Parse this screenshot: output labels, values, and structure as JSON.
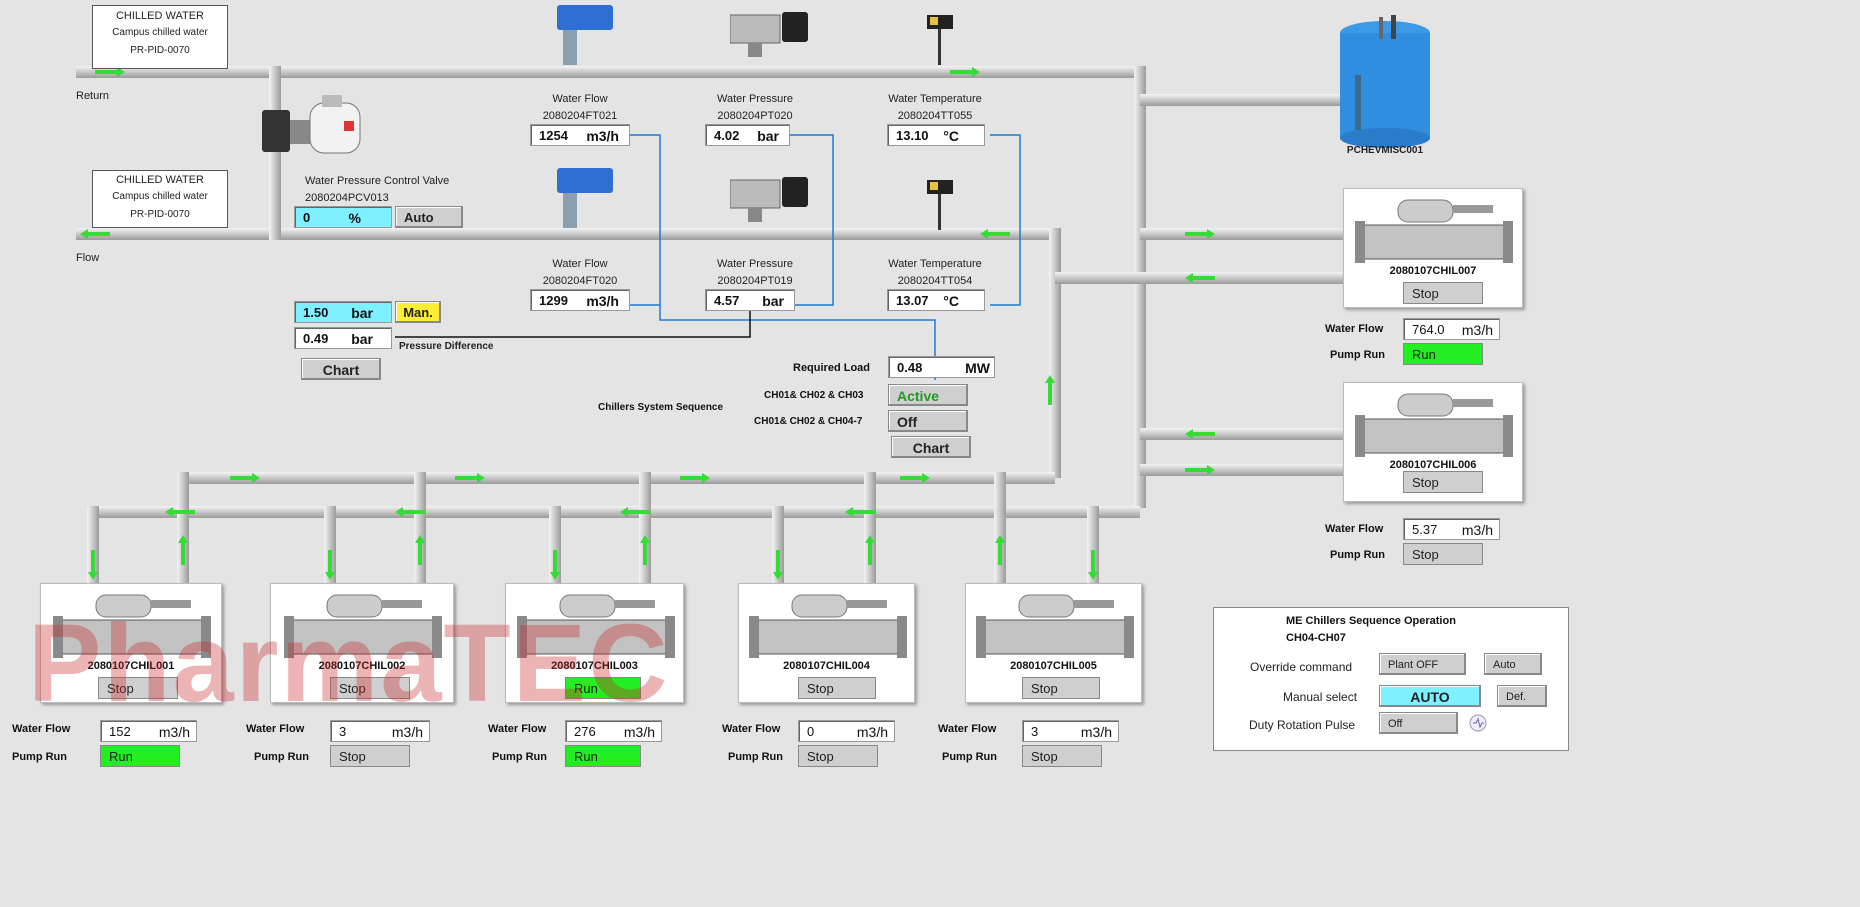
{
  "colors": {
    "pipe": "#c9c9c9",
    "flow_arrow": "#33dd33",
    "run": "#22ee22",
    "signal_line": "#1e7bd0",
    "setpoint_bg": "#7ef0ff",
    "manual_bg": "#ffee33",
    "active_text": "#229922"
  },
  "tag_return": {
    "line1": "CHILLED WATER",
    "line2": "Campus chilled water",
    "line3": "PR-PID-0070"
  },
  "tag_flow": {
    "line1": "CHILLED WATER",
    "line2": "Campus chilled water",
    "line3": "PR-PID-0070"
  },
  "return_label": "Return",
  "flow_label": "Flow",
  "pcv": {
    "title": "Water Pressure Control Valve",
    "tag": "2080204PCV013",
    "value": "0",
    "unit": "%",
    "mode": "Auto"
  },
  "return_sensors": {
    "flow": {
      "title": "Water  Flow",
      "tag": "2080204FT021",
      "value": "1254",
      "unit": "m3/h"
    },
    "pressure": {
      "title": "Water Pressure",
      "tag": "2080204PT020",
      "value": "4.02",
      "unit": "bar"
    },
    "temperature": {
      "title": "Water Temperature",
      "tag": "2080204TT055",
      "value": "13.10",
      "unit": "°C"
    }
  },
  "flow_sensors": {
    "flow": {
      "title": "Water Flow",
      "tag": "2080204FT020",
      "value": "1299",
      "unit": "m3/h"
    },
    "pressure": {
      "title": "Water Pressure",
      "tag": "2080204PT019",
      "value": "4.57",
      "unit": "bar"
    },
    "temperature": {
      "title": "Water Temperature",
      "tag": "2080204TT054",
      "value": "13.07",
      "unit": "°C"
    }
  },
  "dp": {
    "setpoint": "1.50",
    "setpoint_unit": "bar",
    "mode": "Man.",
    "actual": "0.49",
    "actual_unit": "bar",
    "label": "Pressure Difference",
    "chart_button": "Chart"
  },
  "load": {
    "label": "Required Load",
    "value": "0.48",
    "unit": "MW"
  },
  "sequence": {
    "label": "Chillers System Sequence",
    "row1_label": "CH01& CH02 & CH03",
    "row1_status": "Active",
    "row2_label": "CH01& CH02 & CH04-7",
    "row2_status": "Off",
    "chart_button": "Chart"
  },
  "tank": {
    "name": "PCHEVMISC001"
  },
  "chillers": [
    {
      "name": "2080107CHIL001",
      "status": "Stop",
      "flow_label": "Water Flow",
      "flow": "152",
      "unit": "m3/h",
      "pump_label": "Pump Run",
      "pump": "Run"
    },
    {
      "name": "2080107CHIL002",
      "status": "Stop",
      "flow_label": "Water Flow",
      "flow": "3",
      "unit": "m3/h",
      "pump_label": "Pump Run",
      "pump": "Stop"
    },
    {
      "name": "2080107CHIL003",
      "status": "Run",
      "flow_label": "Water Flow",
      "flow": "276",
      "unit": "m3/h",
      "pump_label": "Pump Run",
      "pump": "Run"
    },
    {
      "name": "2080107CHIL004",
      "status": "Stop",
      "flow_label": "Water Flow",
      "flow": "0",
      "unit": "m3/h",
      "pump_label": "Pump Run",
      "pump": "Stop"
    },
    {
      "name": "2080107CHIL005",
      "status": "Stop",
      "flow_label": "Water Flow",
      "flow": "3",
      "unit": "m3/h",
      "pump_label": "Pump Run",
      "pump": "Stop"
    },
    {
      "name": "2080107CHIL006",
      "status": "Stop",
      "flow_label": "Water Flow",
      "flow": "5.37",
      "unit": "m3/h",
      "pump_label": "Pump Run",
      "pump": "Stop"
    },
    {
      "name": "2080107CHIL007",
      "status": "Stop",
      "flow_label": "Water Flow",
      "flow": "764.0",
      "unit": "m3/h",
      "pump_label": "Pump Run",
      "pump": "Run"
    }
  ],
  "me_panel": {
    "title": "ME Chillers Sequence Operation",
    "subtitle": "CH04-CH07",
    "override_label": "Override command",
    "override_value": "Plant OFF",
    "override_button": "Auto",
    "manual_label": "Manual select",
    "manual_value": "AUTO",
    "manual_button": "Def.",
    "duty_label": "Duty Rotation Pulse",
    "duty_value": "Off"
  },
  "watermark": "PharmaTEC"
}
